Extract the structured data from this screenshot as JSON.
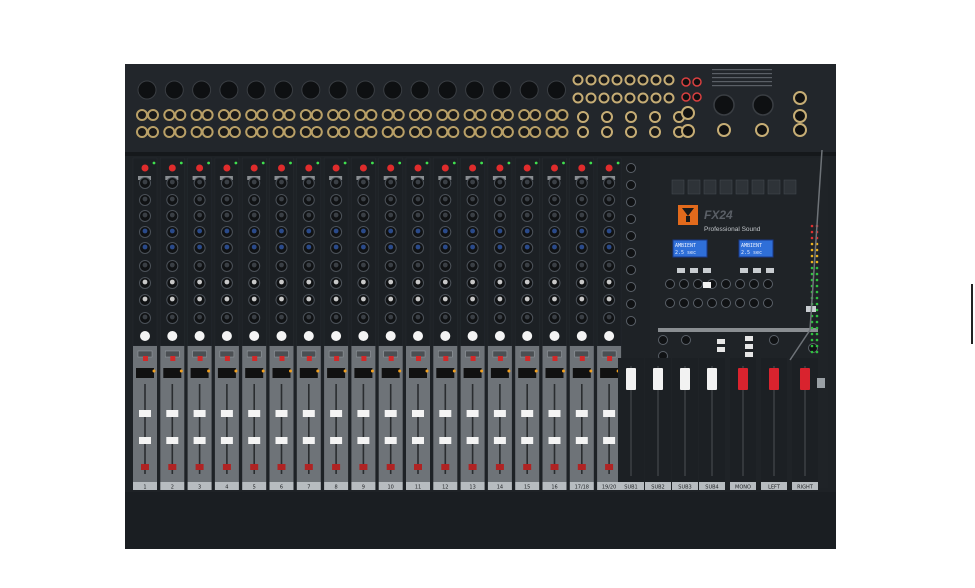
{
  "device": {
    "logo_text": "",
    "model_label": "FX24",
    "subtitle": "Professional Sound",
    "display_left_line1": "AMBIENT",
    "display_left_line2": "2.5 sec",
    "display_right_line1": "AMBIENT",
    "display_right_line2": "2.5 sec"
  },
  "channels": [
    "1",
    "2",
    "3",
    "4",
    "5",
    "6",
    "7",
    "8",
    "9",
    "10",
    "11",
    "12",
    "13",
    "14",
    "15",
    "16",
    "17/18",
    "19/20"
  ],
  "master_labels": [
    "SUB1",
    "SUB2",
    "SUB3",
    "SUB4",
    "MONO",
    "LEFT",
    "RIGHT"
  ],
  "colors": {
    "panel": "#1e2226",
    "fader_strip": "#6e7378",
    "bus_fader": "#f2f2f2",
    "main_fader": "#d9232e",
    "lcd": "#2f6fd8"
  }
}
